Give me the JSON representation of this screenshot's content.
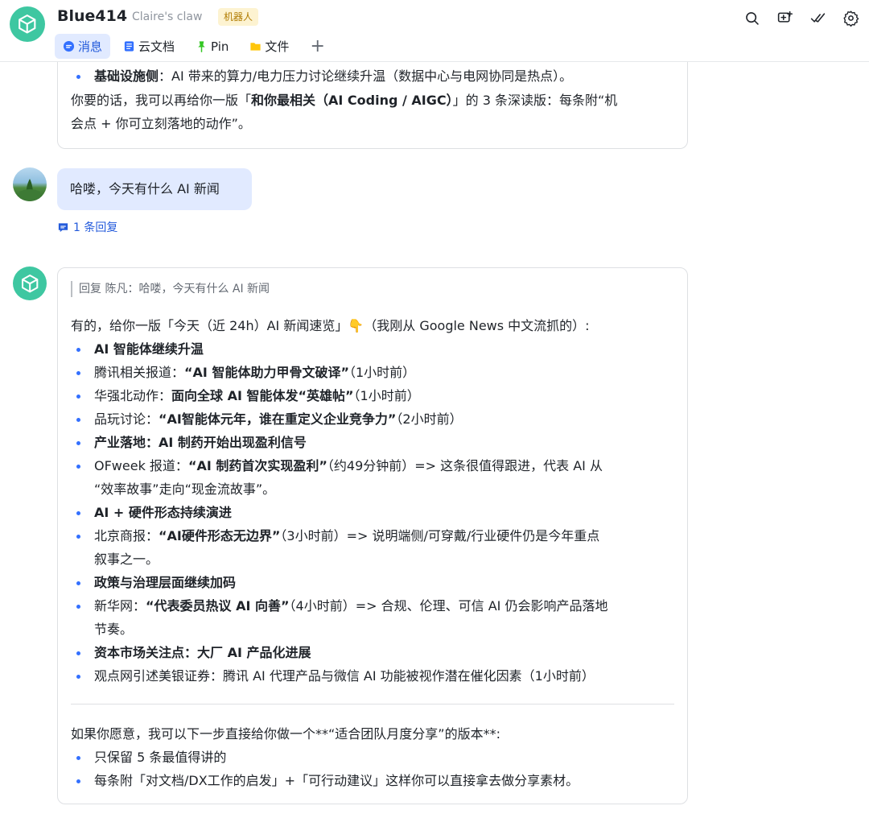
{
  "header": {
    "title": "Blue414",
    "subtitle": "Claire's claw",
    "bot_tag": "机器人",
    "tabs": [
      {
        "label": "消息",
        "icon": "message-icon",
        "active": true
      },
      {
        "label": "云文档",
        "icon": "doc-icon",
        "active": false
      },
      {
        "label": "Pin",
        "icon": "pin-icon",
        "active": false
      },
      {
        "label": "文件",
        "icon": "folder-icon",
        "active": false
      }
    ],
    "add_tab": "+",
    "actions": [
      "search-icon",
      "add-message-icon",
      "checklist-icon",
      "settings-icon"
    ]
  },
  "previous_message": {
    "lines": [
      {
        "bold": "基础设施侧",
        "text": "：AI 带来的算力/电力压力讨论继续升温（数据中心与电网协同是热点）。"
      },
      {
        "pre": "你要的话，我可以再给你一版「",
        "bold": "和你最相关（AI Coding / AIGC）",
        "post": "」的 3 条深读版：每条附“机"
      },
      {
        "text": "会点 + 你可立刻落地的动作”。"
      }
    ]
  },
  "user_message": {
    "text": "哈喽，今天有什么 AI 新闻",
    "reply_count": "1 条回复"
  },
  "bot_message": {
    "quote": "回复 陈凡：哈喽，今天有什么 AI 新闻",
    "intro": "有的，给你一版「今天（近 24h）AI 新闻速览」👇（我刚从 Google News 中文流抓的）:",
    "items": [
      {
        "bold": "AI 智能体继续升温"
      },
      {
        "pre": "腾讯相关报道：",
        "bold": "“AI 智能体助力甲骨文破译”",
        "post": "（1小时前）"
      },
      {
        "pre": "华强北动作：",
        "bold": "面向全球 AI 智能体发“英雄帖”",
        "post": "（1小时前）"
      },
      {
        "pre": "品玩讨论：",
        "bold": "“AI智能体元年，谁在重定义企业竞争力”",
        "post": "（2小时前）"
      },
      {
        "bold": "产业落地：AI 制药开始出现盈利信号"
      },
      {
        "pre": "OFweek 报道：",
        "bold": "“AI 制药首次实现盈利”",
        "post": "（约49分钟前）=> 这条很值得跟进，代表 AI 从",
        "cont": "“效率故事”走向“现金流故事”。"
      },
      {
        "bold": "AI + 硬件形态持续演进"
      },
      {
        "pre": "北京商报：",
        "bold": "“AI硬件形态无边界”",
        "post": "（3小时前）=> 说明端侧/可穿戴/行业硬件仍是今年重点",
        "cont": "叙事之一。"
      },
      {
        "bold": "政策与治理层面继续加码"
      },
      {
        "pre": "新华网：",
        "bold": "“代表委员热议 AI 向善”",
        "post": "（4小时前）=> 合规、伦理、可信 AI 仍会影响产品落地",
        "cont": "节奏。"
      },
      {
        "bold": "资本市场关注点：大厂 AI 产品化进展"
      },
      {
        "pre": "观点网引述美银证券：腾讯 AI 代理产品与微信 AI 功能被视作潜在催化因素（1小时前）"
      }
    ],
    "outro": "如果你愿意，我可以下一步直接给你做一个**“适合团队月度分享”的版本**:",
    "options": [
      "只保留 5 条最值得讲的",
      "每条附「对文档/DX工作的启发」+「可行动建议」这样你可以直接拿去做分享素材。"
    ]
  },
  "colors": {
    "accent": "#3370ff",
    "link": "#245bdb",
    "bot_avatar": "#3ec7a1",
    "user_bubble": "#e1eaff",
    "bot_tag_bg": "#fdf3d1"
  }
}
